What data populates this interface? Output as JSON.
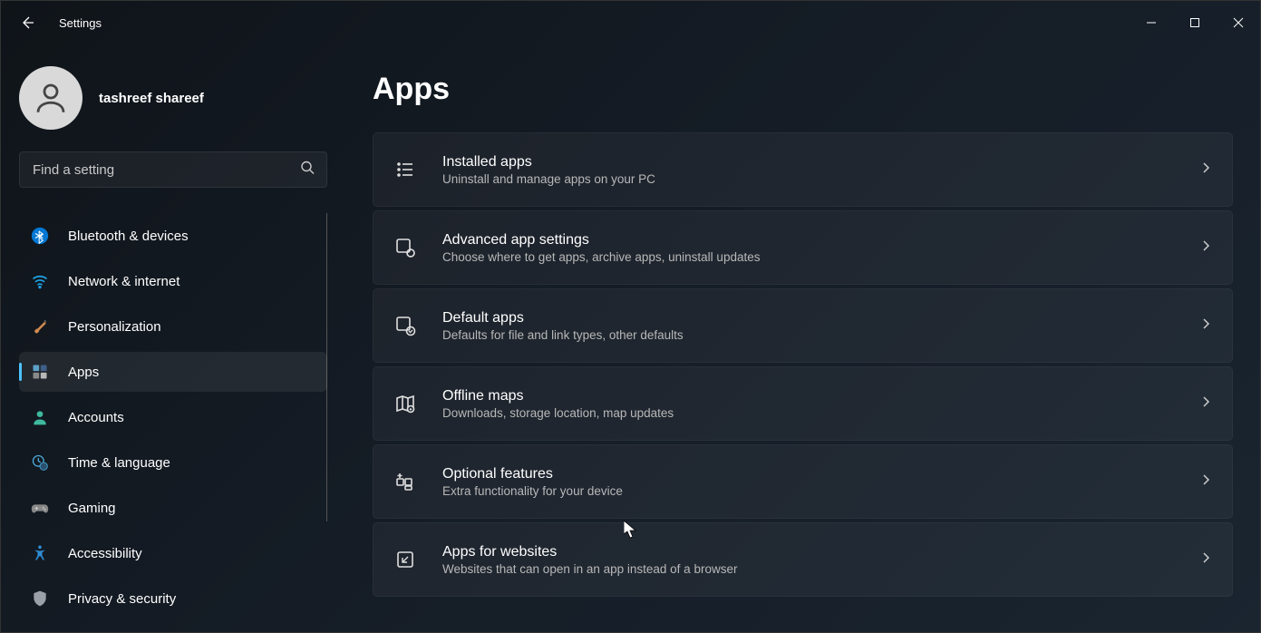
{
  "window": {
    "title": "Settings"
  },
  "user": {
    "name": "tashreef shareef"
  },
  "search": {
    "placeholder": "Find a setting"
  },
  "sidebar": {
    "items": [
      {
        "id": "bluetooth-devices",
        "label": "Bluetooth & devices",
        "icon": "bluetooth",
        "active": false
      },
      {
        "id": "network-internet",
        "label": "Network & internet",
        "icon": "wifi",
        "active": false
      },
      {
        "id": "personalization",
        "label": "Personalization",
        "icon": "brush",
        "active": false
      },
      {
        "id": "apps",
        "label": "Apps",
        "icon": "grid",
        "active": true
      },
      {
        "id": "accounts",
        "label": "Accounts",
        "icon": "person",
        "active": false
      },
      {
        "id": "time-language",
        "label": "Time & language",
        "icon": "clock-globe",
        "active": false
      },
      {
        "id": "gaming",
        "label": "Gaming",
        "icon": "gamepad",
        "active": false
      },
      {
        "id": "accessibility",
        "label": "Accessibility",
        "icon": "accessibility",
        "active": false
      },
      {
        "id": "privacy-security",
        "label": "Privacy & security",
        "icon": "shield",
        "active": false
      }
    ]
  },
  "main": {
    "title": "Apps",
    "items": [
      {
        "id": "installed-apps",
        "title": "Installed apps",
        "desc": "Uninstall and manage apps on your PC",
        "icon": "list"
      },
      {
        "id": "advanced-app-settings",
        "title": "Advanced app settings",
        "desc": "Choose where to get apps, archive apps, uninstall updates",
        "icon": "app-gear"
      },
      {
        "id": "default-apps",
        "title": "Default apps",
        "desc": "Defaults for file and link types, other defaults",
        "icon": "app-check"
      },
      {
        "id": "offline-maps",
        "title": "Offline maps",
        "desc": "Downloads, storage location, map updates",
        "icon": "map"
      },
      {
        "id": "optional-features",
        "title": "Optional features",
        "desc": "Extra functionality for your device",
        "icon": "app-plus"
      },
      {
        "id": "apps-for-websites",
        "title": "Apps for websites",
        "desc": "Websites that can open in an app instead of a browser",
        "icon": "app-link"
      }
    ]
  }
}
